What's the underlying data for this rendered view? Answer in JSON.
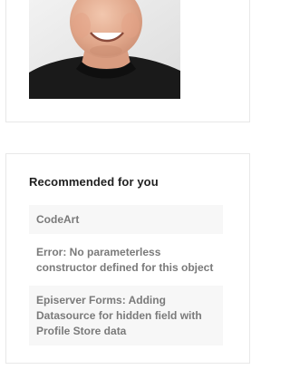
{
  "profile": {
    "avatar_alt": "Profile photo"
  },
  "recommended": {
    "title": "Recommended for you",
    "items": [
      {
        "label": "CodeArt"
      },
      {
        "label": "Error: No parameterless constructor defined for this object"
      },
      {
        "label": "Episerver Forms: Adding Datasource for hidden field with Profile Store data"
      }
    ]
  },
  "colors": {
    "title_text": "#1f1f1f",
    "item_text": "#7a7a7a",
    "item_bg": "#f7f7f7",
    "card_border": "#e8e8e8"
  }
}
